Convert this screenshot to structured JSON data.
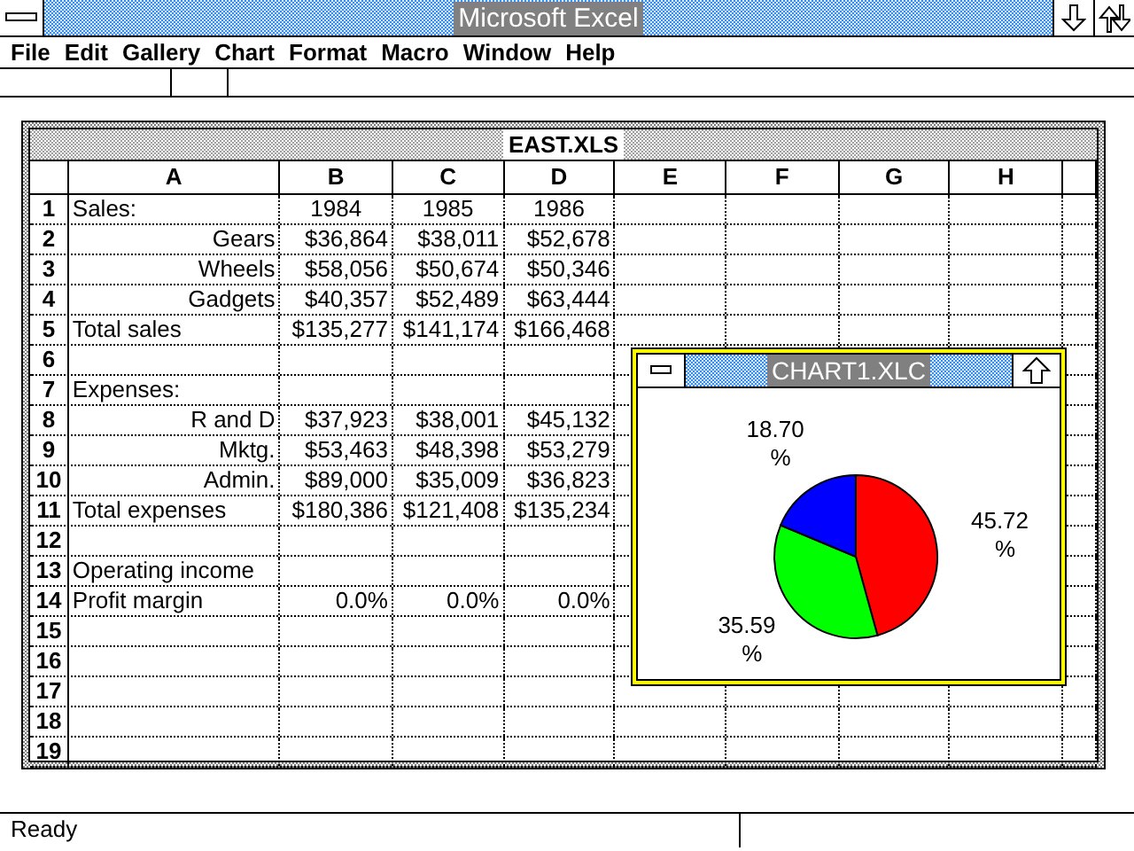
{
  "window": {
    "title": "Microsoft Excel"
  },
  "menu": [
    "File",
    "Edit",
    "Gallery",
    "Chart",
    "Format",
    "Macro",
    "Window",
    "Help"
  ],
  "sheet": {
    "title": "EAST.XLS",
    "columns": [
      "A",
      "B",
      "C",
      "D",
      "E",
      "F",
      "G",
      "H"
    ],
    "rows": [
      {
        "number": "1",
        "label": "Sales:",
        "label_indented": false,
        "values": [
          "1984",
          "1985",
          "1986"
        ],
        "values_centered": true
      },
      {
        "number": "2",
        "label": "Gears",
        "label_indented": true,
        "values": [
          "$36,864",
          "$38,011",
          "$52,678"
        ],
        "values_centered": false
      },
      {
        "number": "3",
        "label": "Wheels",
        "label_indented": true,
        "values": [
          "$58,056",
          "$50,674",
          "$50,346"
        ],
        "values_centered": false
      },
      {
        "number": "4",
        "label": "Gadgets",
        "label_indented": true,
        "values": [
          "$40,357",
          "$52,489",
          "$63,444"
        ],
        "values_centered": false
      },
      {
        "number": "5",
        "label": "Total sales",
        "label_indented": false,
        "values": [
          "$135,277",
          "$141,174",
          "$166,468"
        ],
        "values_centered": false
      },
      {
        "number": "6"
      },
      {
        "number": "7",
        "label": "Expenses:",
        "label_indented": false
      },
      {
        "number": "8",
        "label": "R and D",
        "label_indented": true,
        "values": [
          "$37,923",
          "$38,001",
          "$45,132"
        ],
        "values_centered": false
      },
      {
        "number": "9",
        "label": "Mktg.",
        "label_indented": true,
        "values": [
          "$53,463",
          "$48,398",
          "$53,279"
        ],
        "values_centered": false
      },
      {
        "number": "10",
        "label": "Admin.",
        "label_indented": true,
        "values": [
          "$89,000",
          "$35,009",
          "$36,823"
        ],
        "values_centered": false
      },
      {
        "number": "11",
        "label": "Total expenses",
        "label_indented": false,
        "values": [
          "$180,386",
          "$121,408",
          "$135,234"
        ],
        "values_centered": false
      },
      {
        "number": "12"
      },
      {
        "number": "13",
        "label": "Operating income",
        "label_indented": false
      },
      {
        "number": "14",
        "label": "Profit margin",
        "label_indented": false,
        "values": [
          "0.0%",
          "0.0%",
          "0.0%"
        ],
        "values_centered": false
      },
      {
        "number": "15"
      },
      {
        "number": "16"
      },
      {
        "number": "17"
      },
      {
        "number": "18"
      },
      {
        "number": "19"
      }
    ]
  },
  "chart_window": {
    "title": "CHART1.XLC",
    "chart_data": {
      "type": "pie",
      "values": [
        45.72,
        35.59,
        18.7
      ],
      "colors": [
        "#ff0000",
        "#00ff00",
        "#0000ff"
      ],
      "data_labels": true,
      "value_labels": [
        [
          "45.72",
          "%"
        ],
        [
          "35.59",
          "%"
        ],
        [
          "18.70",
          "%"
        ]
      ]
    }
  },
  "status_bar": {
    "text": "Ready"
  }
}
